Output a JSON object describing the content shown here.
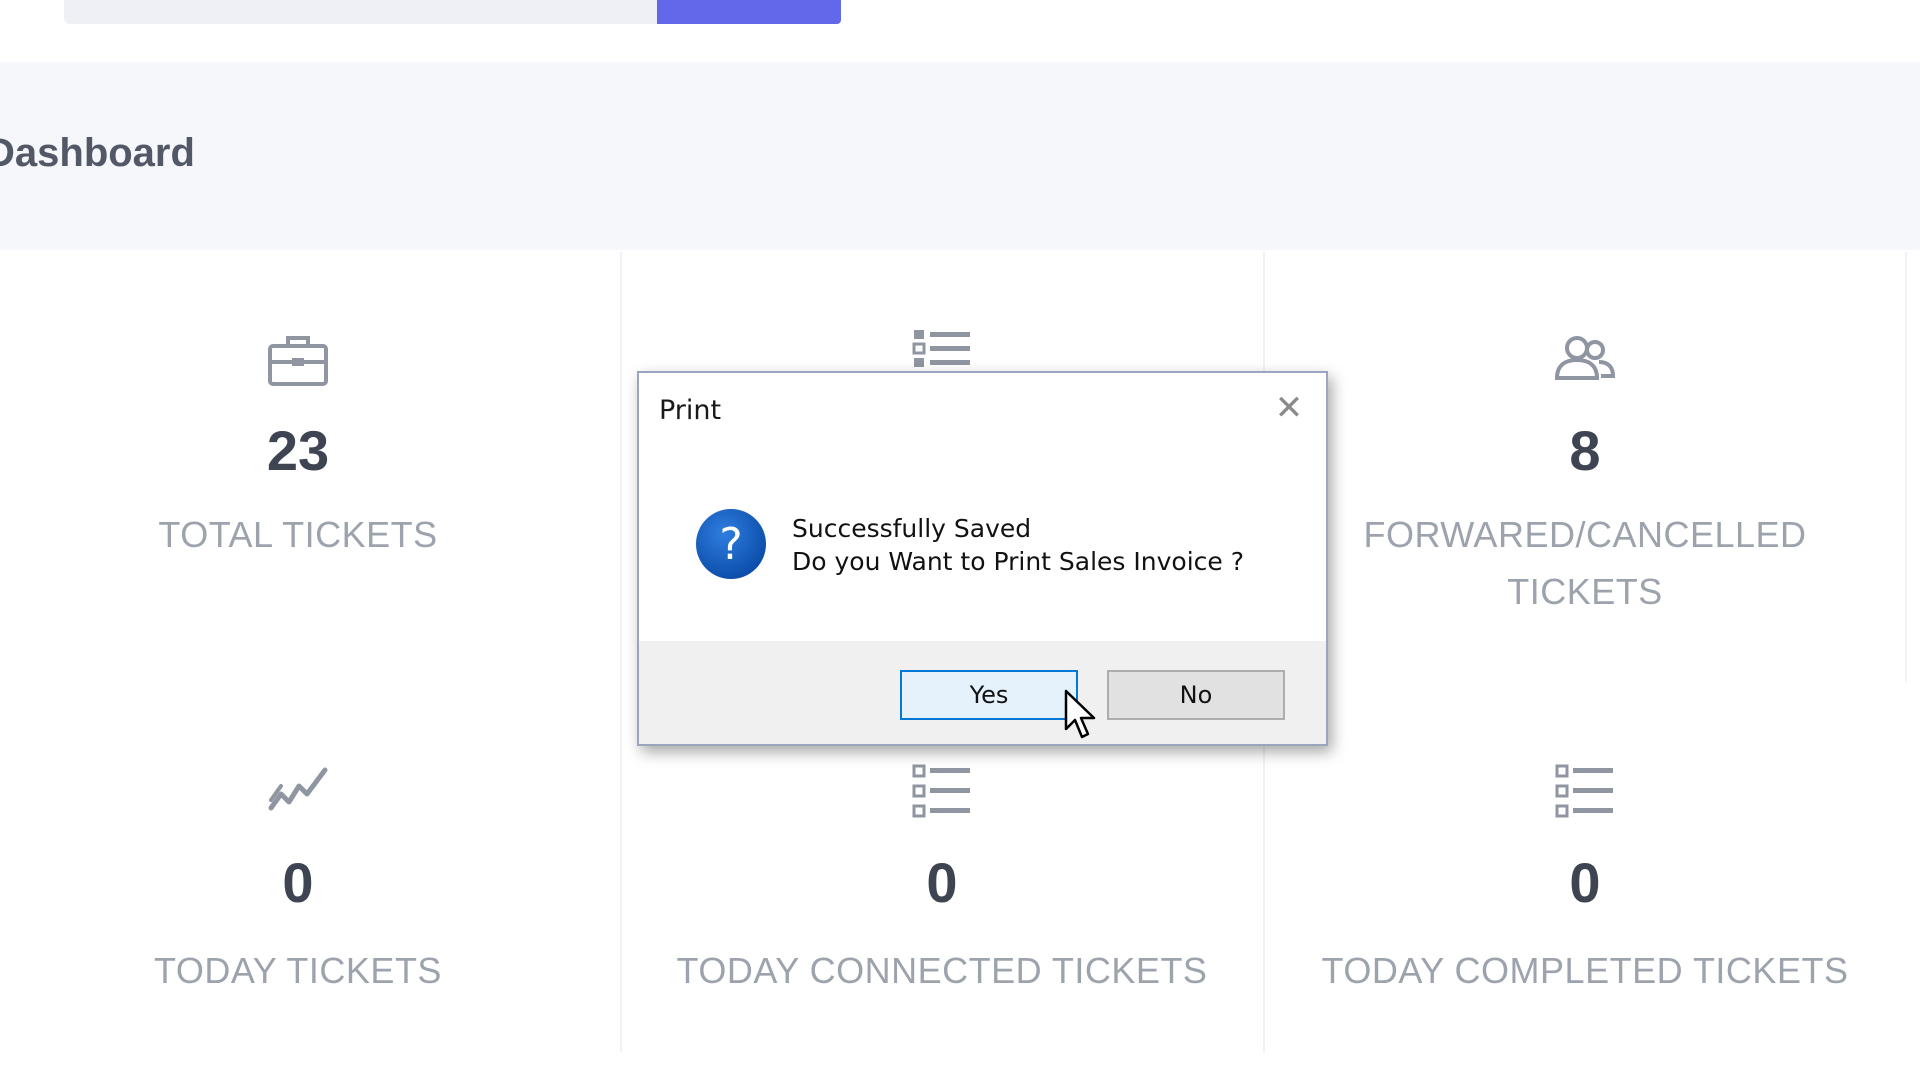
{
  "page": {
    "title": "Dashboard"
  },
  "stats": [
    {
      "value": "23",
      "label_lines": [
        "TOTAL TICKETS"
      ],
      "icon": "briefcase-icon"
    },
    {
      "value": "",
      "label_lines": [],
      "icon": "list-icon"
    },
    {
      "value": "8",
      "label_lines": [
        "FORWARED/CANCELLED",
        "TICKETS"
      ],
      "icon": "users-icon"
    },
    {
      "value": "0",
      "label_lines": [
        "TODAY TICKETS"
      ],
      "icon": "trend-icon"
    },
    {
      "value": "0",
      "label_lines": [
        "TODAY CONNECTED TICKETS"
      ],
      "icon": "list-icon"
    },
    {
      "value": "0",
      "label_lines": [
        "TODAY COMPLETED TICKETS"
      ],
      "icon": "list-icon"
    }
  ],
  "dialog": {
    "title": "Print",
    "message_line1": "Successfully Saved",
    "message_line2": "Do you Want to Print Sales Invoice ?",
    "yes_label": "Yes",
    "no_label": "No",
    "icon": "question-icon"
  },
  "colors": {
    "accent": "#6169ea",
    "stat_value": "#3e4452",
    "stat_label": "#9da3ad",
    "dialog_icon": "#0f56b3"
  }
}
